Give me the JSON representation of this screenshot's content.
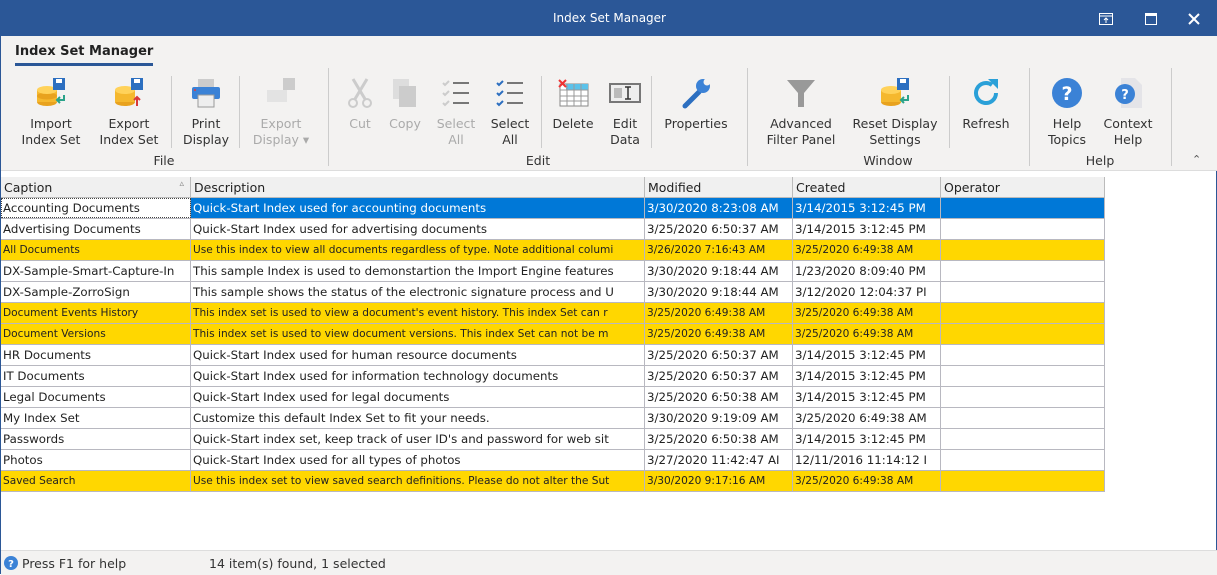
{
  "window": {
    "title": "Index Set Manager"
  },
  "ribbon": {
    "tab": "Index Set Manager",
    "buttons": [
      {
        "label1": "Import",
        "label2": "Index Set",
        "icon": "import-db-icon",
        "enabled": true
      },
      {
        "label1": "Export",
        "label2": "Index Set",
        "icon": "export-db-icon",
        "enabled": true
      },
      {
        "label1": "Print",
        "label2": "Display",
        "icon": "printer-icon",
        "enabled": true
      },
      {
        "label1": "Export",
        "label2": "Display ▾",
        "icon": "export-display-icon",
        "enabled": false
      },
      {
        "label1": "Cut",
        "label2": "",
        "icon": "scissors-icon",
        "enabled": false
      },
      {
        "label1": "Copy",
        "label2": "",
        "icon": "copy-icon",
        "enabled": false
      },
      {
        "label1": "Select",
        "label2": "All",
        "icon": "checklist-icon",
        "enabled": false
      },
      {
        "label1": "Select",
        "label2": "All",
        "icon": "checklist-icon",
        "enabled": true
      },
      {
        "label1": "Delete",
        "label2": "",
        "icon": "delete-table-icon",
        "enabled": true
      },
      {
        "label1": "Edit",
        "label2": "Data",
        "icon": "edit-field-icon",
        "enabled": true
      },
      {
        "label1": "Properties",
        "label2": "",
        "icon": "wrench-icon",
        "enabled": true
      },
      {
        "label1": "Advanced",
        "label2": "Filter Panel",
        "icon": "funnel-icon",
        "enabled": true
      },
      {
        "label1": "Reset Display",
        "label2": "Settings",
        "icon": "reset-db-icon",
        "enabled": true
      },
      {
        "label1": "Refresh",
        "label2": "",
        "icon": "refresh-icon",
        "enabled": true
      },
      {
        "label1": "Help",
        "label2": "Topics",
        "icon": "help-icon",
        "enabled": true
      },
      {
        "label1": "Context",
        "label2": "Help",
        "icon": "context-help-icon",
        "enabled": true
      }
    ],
    "groups": [
      "File",
      "Edit",
      "Window",
      "Help"
    ]
  },
  "grid": {
    "columns": [
      "Caption",
      "Description",
      "Modified",
      "Created",
      "Operator"
    ],
    "rows": [
      [
        "Accounting Documents",
        "Quick-Start Index used for accounting documents",
        "3/30/2020 8:23:08 AM",
        "3/14/2015 3:12:45 PM",
        ""
      ],
      [
        "Advertising Documents",
        "Quick-Start Index used for advertising documents",
        "3/25/2020 6:50:37 AM",
        "3/14/2015 3:12:45 PM",
        ""
      ],
      [
        "All Documents",
        "Use this index to view all documents regardless of type. Note additional columi",
        "3/26/2020 7:16:43 AM",
        "3/25/2020 6:49:38 AM",
        ""
      ],
      [
        "DX-Sample-Smart-Capture-In",
        "This sample Index is used to demonstartion the Import Engine features",
        "3/30/2020 9:18:44 AM",
        "1/23/2020 8:09:40 PM",
        ""
      ],
      [
        "DX-Sample-ZorroSign",
        "This sample shows the status of the electronic signature process and U",
        "3/30/2020 9:18:44 AM",
        "3/12/2020 12:04:37 PI",
        ""
      ],
      [
        "Document Events History",
        "This index set is used to view a document's event history. This index Set can r",
        "3/25/2020 6:49:38 AM",
        "3/25/2020 6:49:38 AM",
        ""
      ],
      [
        "Document Versions",
        "This index set is used to view document versions. This index Set can not be m",
        "3/25/2020 6:49:38 AM",
        "3/25/2020 6:49:38 AM",
        ""
      ],
      [
        "HR Documents",
        "Quick-Start Index used for human resource documents",
        "3/25/2020 6:50:37 AM",
        "3/14/2015 3:12:45 PM",
        ""
      ],
      [
        "IT Documents",
        "Quick-Start Index used for information technology documents",
        "3/25/2020 6:50:37 AM",
        "3/14/2015 3:12:45 PM",
        ""
      ],
      [
        "Legal Documents",
        "Quick-Start Index used for legal documents",
        "3/25/2020 6:50:38 AM",
        "3/14/2015 3:12:45 PM",
        ""
      ],
      [
        "My Index Set",
        "Customize this default Index Set to fit your needs.",
        "3/30/2020 9:19:09 AM",
        "3/25/2020 6:49:38 AM",
        ""
      ],
      [
        "Passwords",
        "Quick-Start index set, keep track of user ID's and password for web sit",
        "3/25/2020 6:50:38 AM",
        "3/14/2015 3:12:45 PM",
        ""
      ],
      [
        "Photos",
        "Quick-Start Index used for all types of photos",
        "3/27/2020 11:42:47 AI",
        "12/11/2016 11:14:12 I",
        ""
      ],
      [
        "Saved Search",
        "Use this index set to view saved search definitions. Please do not alter the Sut",
        "3/30/2020 9:17:16 AM",
        "3/25/2020 6:49:38 AM",
        ""
      ]
    ],
    "highlighted_rows": [
      2,
      5,
      6,
      13
    ],
    "selected_row": 0,
    "highlight_color": "#ffd700",
    "selection_color": "#0078d7"
  },
  "status": {
    "help": "Press F1 for help",
    "count": "14 item(s) found, 1 selected"
  }
}
